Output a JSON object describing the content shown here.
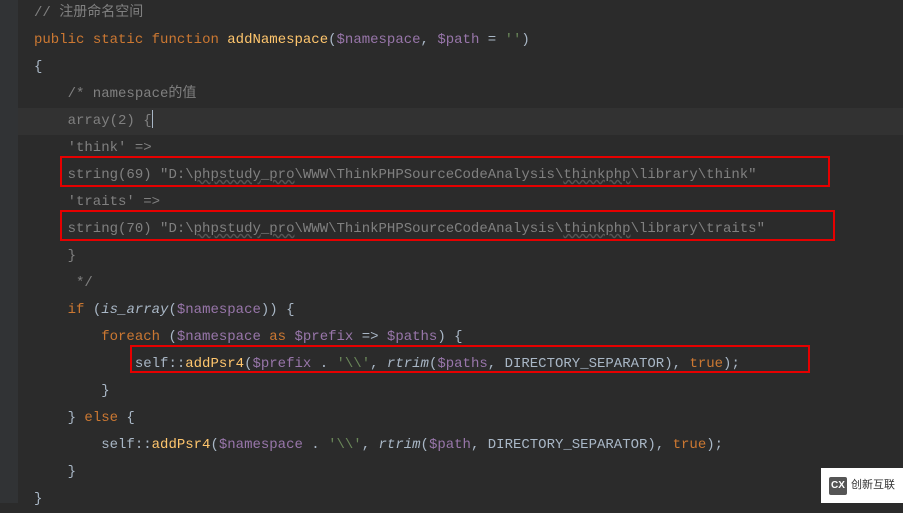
{
  "code": {
    "line1_comment": "// 注册命名空间",
    "line2_kw_public": "public",
    "line2_kw_static": "static",
    "line2_kw_function": "function",
    "line2_func": "addNamespace",
    "line2_var1": "$namespace",
    "line2_var2": "$path",
    "line2_default": "''",
    "line3": "{",
    "line4": "    /* namespace的值",
    "line5_a": "    array(",
    "line5_num": "2",
    "line5_b": ") {",
    "line6": "    'think' =>",
    "line7_a": "    string(",
    "line7_num": "69",
    "line7_b": ") \"D:\\",
    "line7_u1": "phpstudy",
    "line7_c": "_",
    "line7_u2": "pro",
    "line7_d": "\\WWW\\ThinkPHPSourceCodeAnalysis\\",
    "line7_u3": "thinkphp",
    "line7_e": "\\library\\think\"",
    "line8": "    'traits' =>",
    "line9_a": "    string(",
    "line9_num": "70",
    "line9_b": ") \"D:\\",
    "line9_u1": "phpstudy",
    "line9_c": "_",
    "line9_u2": "pro",
    "line9_d": "\\WWW\\ThinkPHPSourceCodeAnalysis\\",
    "line9_u3": "thinkphp",
    "line9_e": "\\library\\traits\"",
    "line10": "    }",
    "line11": "     */",
    "line12_if": "if",
    "line12_func": "is_array",
    "line12_var": "$namespace",
    "line13_foreach": "foreach",
    "line13_var1": "$namespace",
    "line13_as": "as",
    "line13_var2": "$prefix",
    "line13_var3": "$paths",
    "line14_self": "self",
    "line14_method": "addPsr4",
    "line14_var1": "$prefix",
    "line14_str1": "'\\\\'",
    "line14_rtrim": "rtrim",
    "line14_var2": "$paths",
    "line14_const": "DIRECTORY_SEPARATOR",
    "line14_true": "true",
    "line15": "        }",
    "line16": "    } ",
    "line16_else": "else",
    "line16_b": " {",
    "line17_self": "self",
    "line17_method": "addPsr4",
    "line17_var1": "$namespace",
    "line17_str1": "'\\\\'",
    "line17_rtrim": "rtrim",
    "line17_var2": "$path",
    "line17_const": "DIRECTORY_SEPARATOR",
    "line17_true": "true",
    "line18": "    }",
    "line19": "}"
  },
  "watermark": {
    "icon": "CX",
    "text": "创新互联"
  }
}
